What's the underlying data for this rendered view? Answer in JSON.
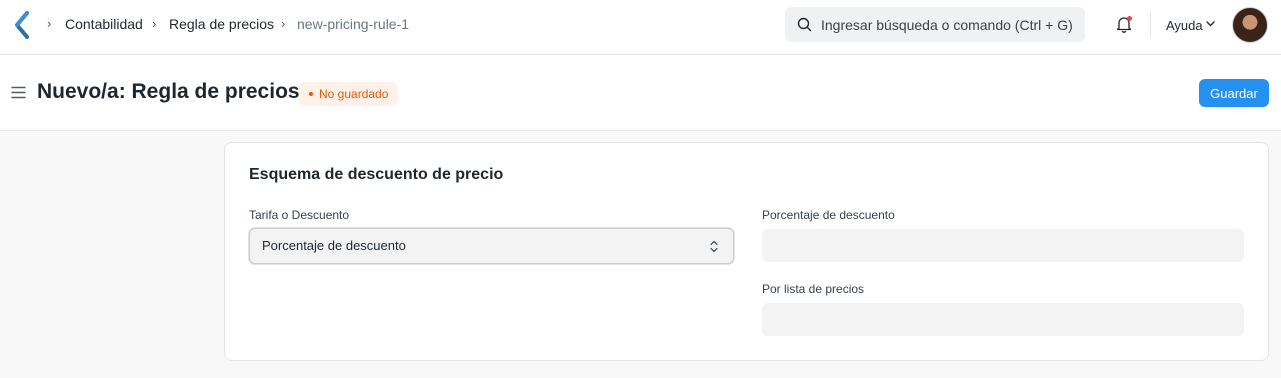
{
  "navbar": {
    "breadcrumbs": [
      "Contabilidad",
      "Regla de precios",
      "new-pricing-rule-1"
    ],
    "search_placeholder": "Ingresar búsqueda o comando (Ctrl + G)",
    "help_label": "Ayuda",
    "icons": [
      "app-logo-icon",
      "search-icon",
      "notification-bell-icon",
      "chevron-down-icon"
    ]
  },
  "page": {
    "title": "Nuevo/a: Regla de precios",
    "status": "No guardado",
    "save_label": "Guardar"
  },
  "form": {
    "section_title": "Esquema de descuento de precio",
    "rate_or_discount": {
      "label": "Tarifa o Descuento",
      "value": "Porcentaje de descuento"
    },
    "discount_percentage": {
      "label": "Porcentaje de descuento",
      "value": ""
    },
    "for_price_list": {
      "label": "Por lista de precios",
      "value": ""
    }
  },
  "colors": {
    "primary": "#2490ef",
    "status_text": "#e8590c",
    "status_bg": "#fff1e7"
  }
}
